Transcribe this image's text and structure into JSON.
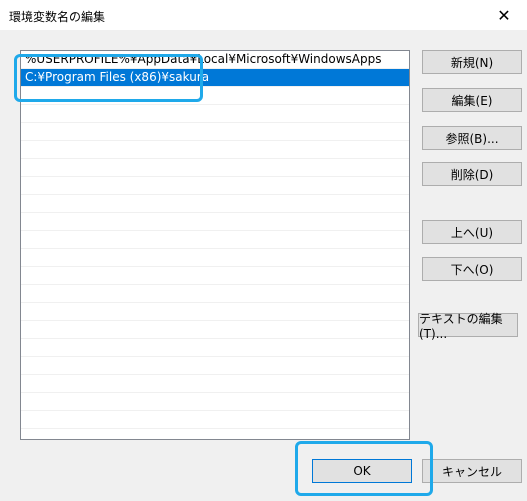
{
  "dialog": {
    "title": "環境変数名の編集",
    "close_label": "✕"
  },
  "list": {
    "items": [
      "%USERPROFILE%¥AppData¥Local¥Microsoft¥WindowsApps",
      "C:¥Program Files (x86)¥sakura",
      "",
      "",
      "",
      "",
      "",
      "",
      "",
      "",
      "",
      "",
      "",
      "",
      "",
      "",
      "",
      "",
      "",
      "",
      "",
      ""
    ],
    "selected_index": 1
  },
  "buttons": {
    "new": "新規(N)",
    "edit": "編集(E)",
    "browse": "参照(B)...",
    "delete": "削除(D)",
    "up": "上へ(U)",
    "down": "下へ(O)",
    "edit_text": "テキストの編集(T)...",
    "ok": "OK",
    "cancel": "キャンセル"
  },
  "colors": {
    "selection": "#0078d7",
    "callout": "#1fa9ea"
  }
}
